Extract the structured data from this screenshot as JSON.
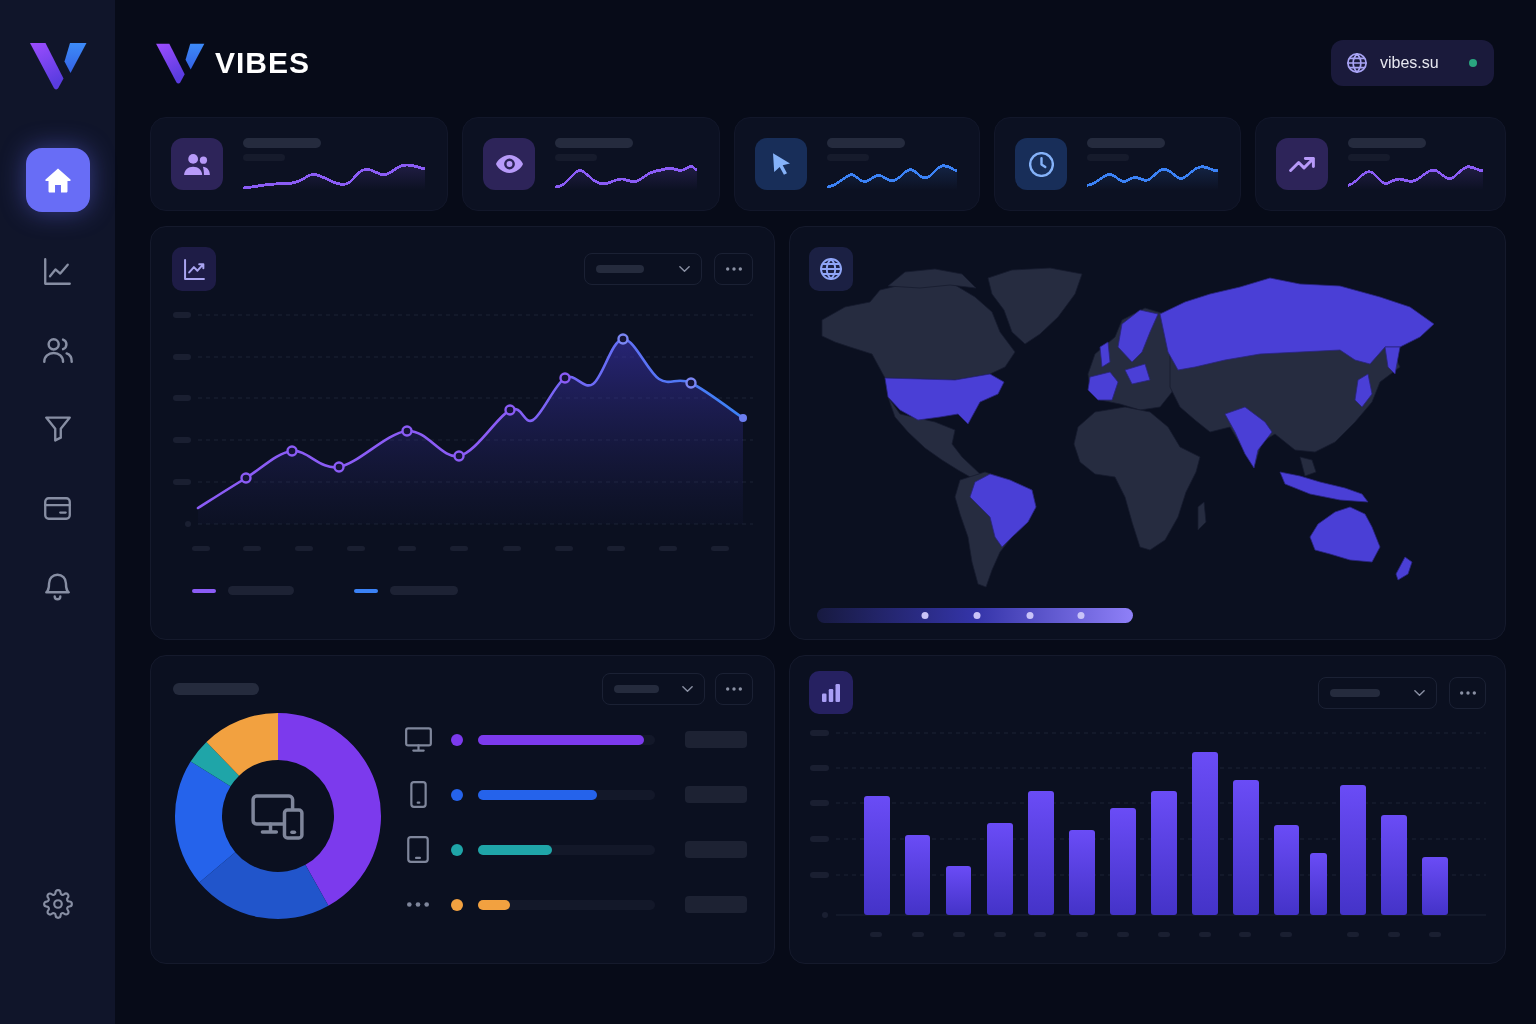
{
  "sidebar": {
    "items": [
      {
        "selected": true
      },
      {
        "selected": false
      },
      {
        "selected": false
      },
      {
        "selected": false
      },
      {
        "selected": false
      },
      {
        "selected": false
      }
    ],
    "footer_items": [
      {
        "selected": false
      }
    ]
  },
  "header": {
    "brand": "VIBES",
    "site": {
      "label": "vibes.su",
      "online": true
    }
  },
  "stat_cards": [
    {
      "color": "#8b5cf6"
    },
    {
      "color": "#8b5cf6"
    },
    {
      "color": "#3b82f6"
    },
    {
      "color": "#3b82f6"
    },
    {
      "color": "#8b5cf6"
    }
  ],
  "line_chart_panel": {
    "legend": [
      {
        "color": "#8b5cf6"
      },
      {
        "color": "#3b82f6"
      }
    ]
  },
  "device_panel": {
    "devices": [
      {
        "color": "#7c3aed",
        "level": 0.94
      },
      {
        "color": "#2563eb",
        "level": 0.67
      },
      {
        "color": "#1fa5a8",
        "level": 0.42
      },
      {
        "color": "#f2a140",
        "level": 0.18
      }
    ]
  }
}
